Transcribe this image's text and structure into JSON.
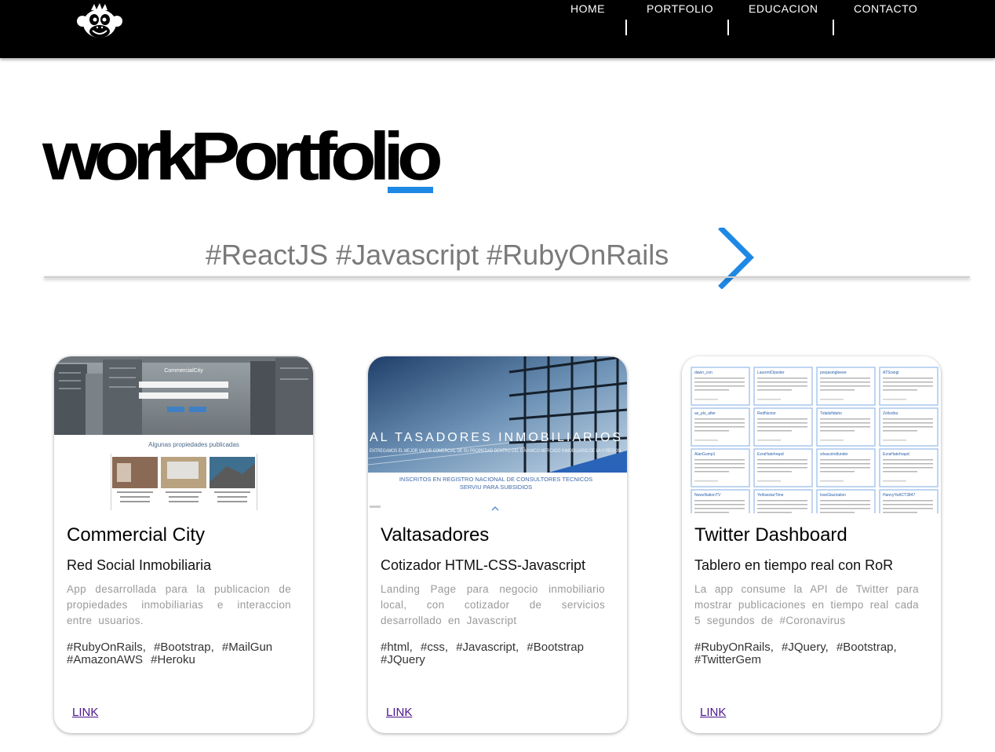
{
  "nav": {
    "items": [
      "HOME",
      "PORTFOLIO",
      "EDUCACION",
      "CONTACTO"
    ],
    "logo_icon": "monkey-logo-icon"
  },
  "hero": {
    "title": "workPortfolio",
    "accent_color": "#1e88e5"
  },
  "carousel": {
    "text": "#ReactJS #Javascript #RubyOnRails",
    "next_icon": "chevron-right-icon"
  },
  "projects": [
    {
      "title": "Commercial City",
      "subtitle": "Red Social Inmobiliaria",
      "description": "App desarrollada para la publicacion de propiedades inmobiliarias e interaccion entre usuarios.",
      "tags": "#RubyOnRails, #Bootstrap, #MailGun #AmazonAWS #Heroku",
      "link_label": "LINK",
      "screenshot": {
        "brand": "CommercialCity",
        "heading": "Algunas propiedades publicadas"
      }
    },
    {
      "title": "Valtasadores",
      "subtitle": "Cotizador HTML-CSS-Javascript",
      "description": "Landing Page para negocio inmobiliario local, con cotizador de servicios desarrollado en Javascript",
      "tags": "#html, #css, #Javascript, #Bootstrap #JQuery",
      "link_label": "LINK",
      "screenshot": {
        "banner": "AL TASADORES INMOBILIARIOS",
        "tagline": "ENTREGAMOS EL MEJOR VALOR COMERCIAL DE SU PROPIEDAD DENTRO DEL DINAMICO MERCADO INMOBILIARIO DE LA V REGION",
        "caption_1": "INSCRITOS EN REGISTRO NACIONAL DE CONSULTORES TECNICOS",
        "caption_2": "SERVIU PARA SUBSIDIOS"
      }
    },
    {
      "title": "Twitter Dashboard",
      "subtitle": "Tablero en tiempo real con RoR",
      "description": "La app consume la API de Twitter para mostrar publicaciones en tiempo real cada 5 segundos de #Coronavirus",
      "tags": "#RubyOnRails, #JQuery, #Bootstrap, #TwitterGem",
      "link_label": "LINK",
      "screenshot": {
        "users": [
          "dawn_con",
          "LaurentOpsoter",
          "poojasingleeee",
          "ATSrangi",
          "as_pls_afier",
          "RedNector",
          "Tidalisfidaho",
          "Zeliodira",
          "AlanGump1",
          "EzraHatehrapd",
          "silvacoindlunder",
          "EzraHatehrapd",
          "NewsNationTV",
          "YellowstarTime",
          "loseGlaziration",
          "HannyYeACT3847"
        ]
      }
    }
  ]
}
